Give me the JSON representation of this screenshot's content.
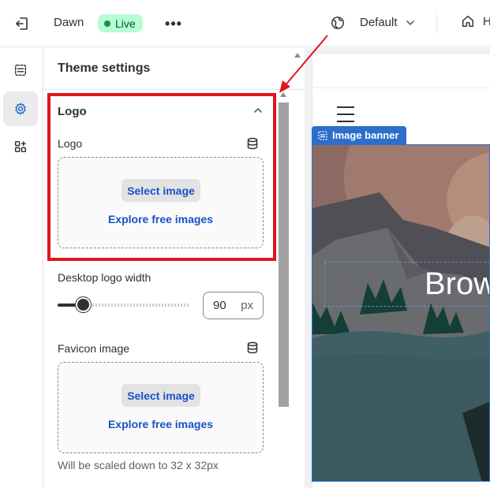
{
  "topbar": {
    "theme_name": "Dawn",
    "live_badge": "Live",
    "more_label": "•••",
    "view_select": "Default",
    "home_label": "H"
  },
  "rail": {
    "items": [
      "sections",
      "theme-settings",
      "app-embeds"
    ],
    "active": "theme-settings"
  },
  "panel": {
    "title": "Theme settings",
    "logo_section": {
      "heading": "Logo",
      "field_label": "Logo",
      "select_button": "Select image",
      "explore_link": "Explore free images"
    },
    "desktop_logo_width": {
      "label": "Desktop logo width",
      "value": "90",
      "unit": "px",
      "slider_fraction": 0.2
    },
    "favicon": {
      "label": "Favicon image",
      "select_button": "Select image",
      "explore_link": "Explore free images",
      "help_text": "Will be scaled down to 32 x 32px"
    }
  },
  "preview": {
    "section_tag": "Image banner",
    "banner_heading": "Brow"
  },
  "colors": {
    "accent_blue": "#2c6ecb",
    "link_blue": "#1a52c6",
    "live_green": "#b4fed2",
    "highlight_red": "#e3141c"
  }
}
